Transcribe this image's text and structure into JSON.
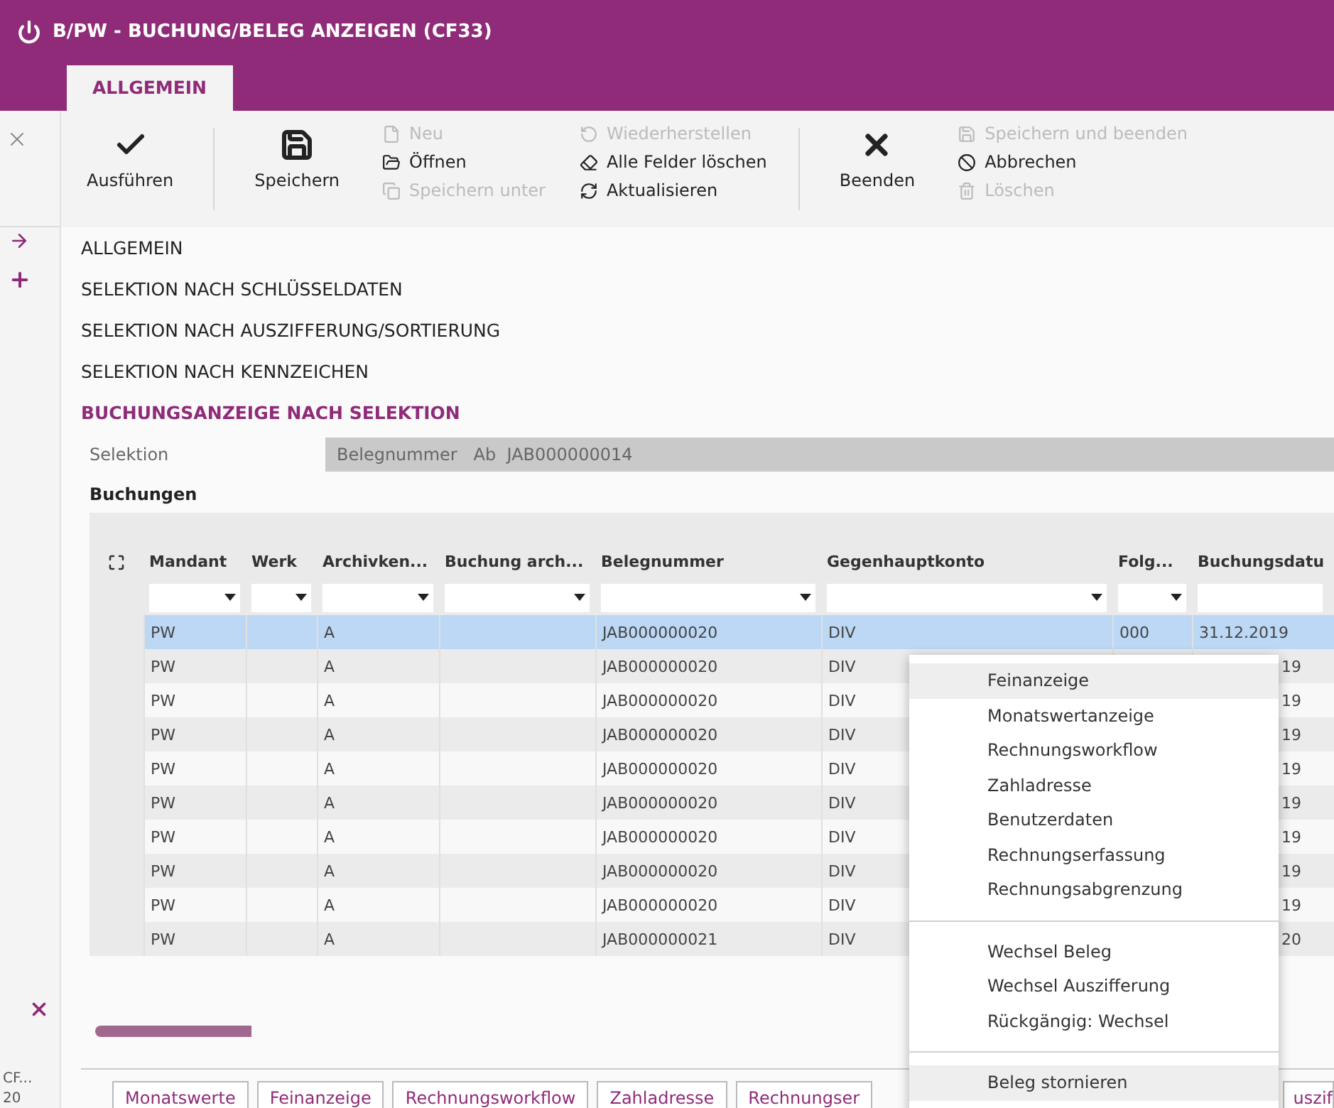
{
  "window": {
    "title": "B/PW - BUCHUNG/BELEG ANZEIGEN (CF33)"
  },
  "tabs": [
    {
      "label": "ALLGEMEIN",
      "selected": true
    }
  ],
  "toolbar": {
    "large_left": [
      {
        "label": "Ausführen"
      },
      {
        "label": "Speichern"
      }
    ],
    "columns": [
      [
        {
          "label": "Neu",
          "disabled": true
        },
        {
          "label": "Öffnen",
          "disabled": false
        },
        {
          "label": "Speichern unter",
          "disabled": true
        }
      ],
      [
        {
          "label": "Wiederherstellen",
          "disabled": true
        },
        {
          "label": "Alle Felder löschen",
          "disabled": false
        },
        {
          "label": "Aktualisieren",
          "disabled": false
        }
      ]
    ],
    "large_right": [
      {
        "label": "Beenden"
      }
    ],
    "columns_right": [
      [
        {
          "label": "Speichern und beenden",
          "disabled": true
        },
        {
          "label": "Abbrechen",
          "disabled": false
        },
        {
          "label": "Löschen",
          "disabled": true
        }
      ]
    ]
  },
  "sidebar": {
    "footer_texts": [
      "CF...",
      "20"
    ]
  },
  "sections": [
    {
      "label": "ALLGEMEIN",
      "active": false
    },
    {
      "label": "SELEKTION NACH SCHLÜSSELDATEN",
      "active": false
    },
    {
      "label": "SELEKTION NACH AUSZIFFERUNG/SORTIERUNG",
      "active": false
    },
    {
      "label": "SELEKTION NACH KENNZEICHEN",
      "active": false
    },
    {
      "label": "BUCHUNGSANZEIGE NACH SELEKTION",
      "active": true
    }
  ],
  "selection": {
    "label": "Selektion",
    "value": "Belegnummer   Ab  JAB000000014"
  },
  "table": {
    "title": "Buchungen",
    "columns": [
      {
        "label": "Mandant",
        "filter": true
      },
      {
        "label": "Werk",
        "filter": true
      },
      {
        "label": "Archivken...",
        "filter": true
      },
      {
        "label": "Buchung arch...",
        "filter": true
      },
      {
        "label": "Belegnummer",
        "filter": true
      },
      {
        "label": "Gegenhauptkonto",
        "filter": true
      },
      {
        "label": "Folg...",
        "filter": true
      },
      {
        "label": "Buchungsdatu",
        "filter": false
      }
    ],
    "rows": [
      {
        "selected": true,
        "cells": [
          "PW",
          "",
          "A",
          "",
          "JAB000000020",
          "DIV",
          "000",
          "31.12.2019"
        ]
      },
      {
        "selected": false,
        "cells": [
          "PW",
          "",
          "A",
          "",
          "JAB000000020",
          "DIV",
          "",
          "19"
        ]
      },
      {
        "selected": false,
        "cells": [
          "PW",
          "",
          "A",
          "",
          "JAB000000020",
          "DIV",
          "",
          "19"
        ]
      },
      {
        "selected": false,
        "cells": [
          "PW",
          "",
          "A",
          "",
          "JAB000000020",
          "DIV",
          "",
          "19"
        ]
      },
      {
        "selected": false,
        "cells": [
          "PW",
          "",
          "A",
          "",
          "JAB000000020",
          "DIV",
          "",
          "19"
        ]
      },
      {
        "selected": false,
        "cells": [
          "PW",
          "",
          "A",
          "",
          "JAB000000020",
          "DIV",
          "",
          "19"
        ]
      },
      {
        "selected": false,
        "cells": [
          "PW",
          "",
          "A",
          "",
          "JAB000000020",
          "DIV",
          "",
          "19"
        ]
      },
      {
        "selected": false,
        "cells": [
          "PW",
          "",
          "A",
          "",
          "JAB000000020",
          "DIV",
          "",
          "19"
        ]
      },
      {
        "selected": false,
        "cells": [
          "PW",
          "",
          "A",
          "",
          "JAB000000020",
          "DIV",
          "",
          "19"
        ]
      },
      {
        "selected": false,
        "cells": [
          "PW",
          "",
          "A",
          "",
          "JAB000000021",
          "DIV",
          "",
          "20"
        ]
      }
    ]
  },
  "context_menu": [
    [
      {
        "label": "Feinanzeige",
        "selected": true
      },
      {
        "label": "Monatswertanzeige",
        "selected": false
      },
      {
        "label": "Rechnungsworkflow",
        "selected": false
      },
      {
        "label": "Zahladresse",
        "selected": false
      },
      {
        "label": "Benutzerdaten",
        "selected": false
      },
      {
        "label": "Rechnungserfassung",
        "selected": false
      },
      {
        "label": "Rechnungsabgrenzung",
        "selected": false
      }
    ],
    [
      {
        "label": "Wechsel Beleg",
        "selected": false
      },
      {
        "label": "Wechsel Auszifferung",
        "selected": false
      },
      {
        "label": "Rückgängig: Wechsel",
        "selected": false
      }
    ],
    [
      {
        "label": "Beleg stornieren",
        "selected": true
      }
    ]
  ],
  "bottom_buttons": [
    "Monatswerte",
    "Feinanzeige",
    "Rechnungsworkflow",
    "Zahladresse",
    "Rechnungser",
    "uszif"
  ]
}
